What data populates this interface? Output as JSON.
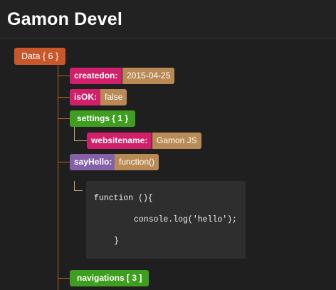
{
  "header": {
    "title": "Gamon Devel"
  },
  "tree": {
    "root_label": "Data { 6 }",
    "createdon": {
      "key": "createdon:",
      "value": "2015-04-25"
    },
    "isOK": {
      "key": "isOK:",
      "value": "false"
    },
    "settings": {
      "label": "settings { 1 }",
      "websitename": {
        "key": "websitename:",
        "value": "Gamon JS"
      }
    },
    "sayHello": {
      "key": "sayHello:",
      "value": "function()",
      "code": [
        "function (){",
        "console.log('hello');",
        "}"
      ]
    },
    "navigations": {
      "label": "navigations [ 3 ]"
    }
  },
  "colors": {
    "root": "#c8582b",
    "key": "#d11f6a",
    "value": "#b98a55",
    "object": "#3f9e1f",
    "function": "#8460a8"
  }
}
